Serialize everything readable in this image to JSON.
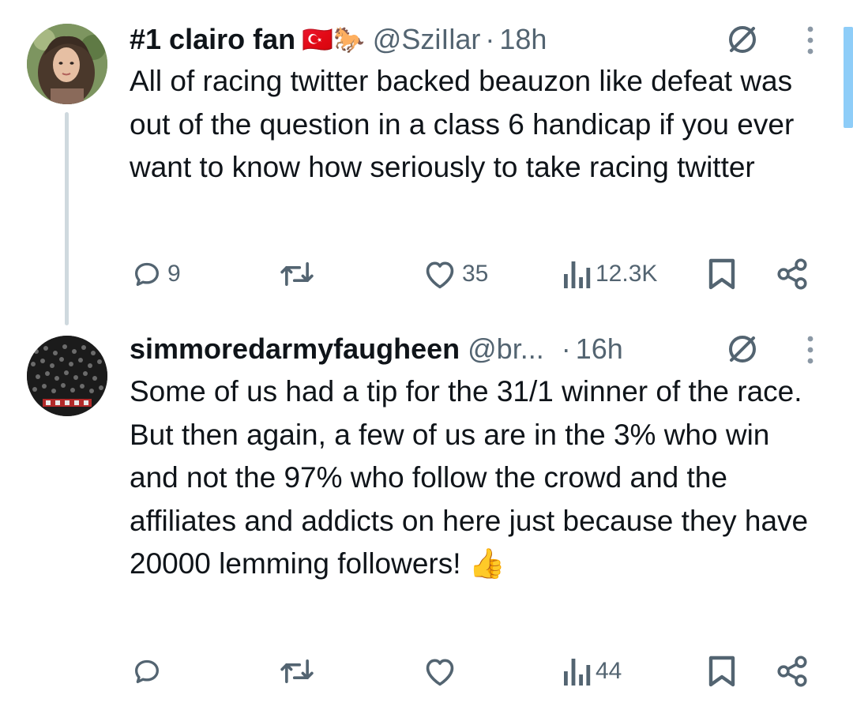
{
  "tweets": [
    {
      "display_name": "#1 clairo fan",
      "flags": "🇹🇷🐎",
      "handle": "@SziIlar",
      "separator": "·",
      "time": "18h",
      "text": "All of racing twitter backed beauzon like defeat was out of the question in a class 6 handicap if you ever want to know how seriously to take racing twitter",
      "replies": "9",
      "retweets": "",
      "likes": "35",
      "views": "12.3K"
    },
    {
      "display_name": "simmoredarmyfaugheen",
      "handle": "@br...",
      "separator": "·",
      "time": "16h",
      "text": "Some of us had a tip for the 31/1 winner of the race. But then again, a few of us are in the 3% who win and not the 97% who follow the crowd and the affiliates and addicts on here just because they have 20000 lemming followers! 👍",
      "replies": "",
      "retweets": "",
      "likes": "",
      "views": "44"
    }
  ],
  "colors": {
    "text": "#0f1419",
    "muted": "#536471",
    "thread_line": "#cfd9de",
    "scroll_indicator": "#8ecdf8"
  },
  "icons": [
    "no-entry-icon",
    "more-vertical-icon",
    "reply-icon",
    "retweet-icon",
    "like-icon",
    "views-icon",
    "bookmark-icon",
    "share-icon"
  ]
}
